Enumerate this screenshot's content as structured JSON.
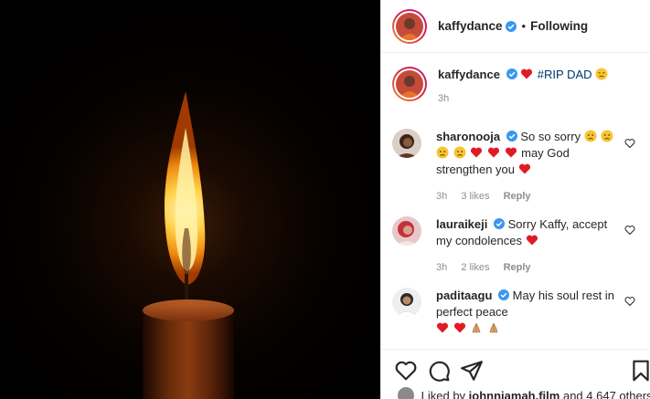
{
  "post": {
    "username": "kaffydance",
    "separator": "•",
    "follow_state": "Following"
  },
  "caption": {
    "username": "kaffydance",
    "text": "#RIP DAD",
    "time": "3h"
  },
  "comments": [
    {
      "username": "sharonooja",
      "text_a": "So so sorry",
      "text_b": "may God strengthen you",
      "time": "3h",
      "likes": "3 likes",
      "reply": "Reply"
    },
    {
      "username": "lauraikeji",
      "text": "Sorry Kaffy, accept my condolences",
      "time": "3h",
      "likes": "2 likes",
      "reply": "Reply"
    },
    {
      "username": "paditaagu",
      "text": "May his soul rest in perfect peace"
    }
  ],
  "likes_line": {
    "prefix": "Liked by",
    "user": "johnnjamah.film",
    "suffix": "and 4,647 others"
  },
  "colors": {
    "verified": "#3897f0",
    "heart": "#ed4956",
    "muted": "#8e8e8e"
  }
}
